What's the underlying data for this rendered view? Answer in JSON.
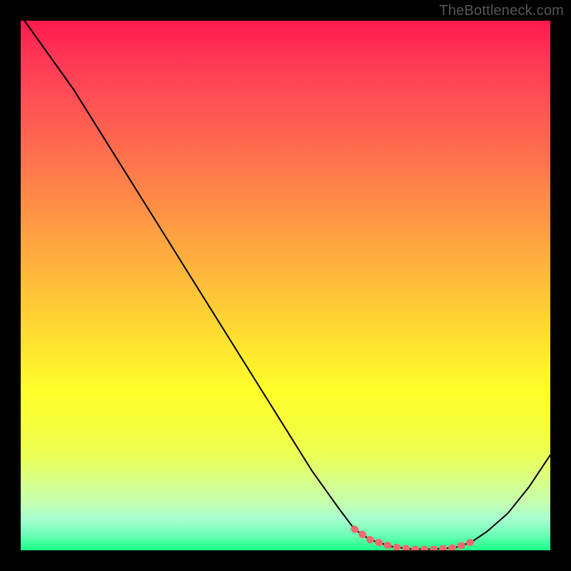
{
  "watermark": "TheBottleneck.com",
  "chart_data": {
    "type": "line",
    "title": "",
    "xlabel": "",
    "ylabel": "",
    "xlim": [
      0,
      100
    ],
    "ylim": [
      0,
      100
    ],
    "series": [
      {
        "name": "bottleneck-curve",
        "x": [
          0,
          5,
          10,
          15,
          20,
          25,
          30,
          35,
          40,
          45,
          50,
          55,
          60,
          63,
          66,
          70,
          74,
          78,
          82,
          85,
          88,
          92,
          96,
          100
        ],
        "values": [
          101,
          94,
          87,
          79,
          71,
          63,
          55,
          47,
          39,
          31,
          23,
          15,
          8,
          4,
          2,
          0.7,
          0.2,
          0.2,
          0.5,
          1.5,
          3.5,
          7,
          12,
          18
        ]
      }
    ],
    "highlight": {
      "name": "optimal-range",
      "x": [
        63,
        66,
        70,
        74,
        78,
        82,
        85
      ],
      "values": [
        4,
        2,
        0.7,
        0.2,
        0.2,
        0.5,
        1.5
      ],
      "color": "#ef6a6f"
    },
    "gradient_stops": [
      {
        "pos": 0,
        "color": "#ff1a4d"
      },
      {
        "pos": 50,
        "color": "#ffc838"
      },
      {
        "pos": 80,
        "color": "#f0ff40"
      },
      {
        "pos": 100,
        "color": "#1aff88"
      }
    ]
  }
}
